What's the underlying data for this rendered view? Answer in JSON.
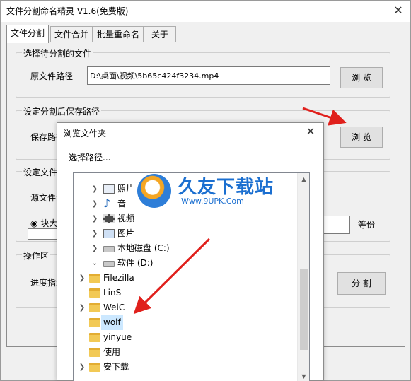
{
  "window": {
    "title": "文件分割命名精灵 V1.6(免费版)",
    "close": "✕"
  },
  "tabs": [
    {
      "label": "文件分割"
    },
    {
      "label": "文件合并"
    },
    {
      "label": "批量重命名"
    },
    {
      "label": "关于"
    }
  ],
  "select_file": {
    "group_title": "选择待分割的文件",
    "label": "原文件路径",
    "value": "D:\\桌面\\视频\\5b65c424f3234.mp4",
    "browse": "浏 览"
  },
  "save_path": {
    "group_title": "设定分割后保存路径",
    "label": "保存路径",
    "browse": "浏 览"
  },
  "settings": {
    "group_title": "设定文件分",
    "size_label": "源文件大",
    "block_label": "块大",
    "equal_label": "等份"
  },
  "operation": {
    "group_title": "操作区",
    "progress_label": "进度指示",
    "split_button": "分 割"
  },
  "dialog": {
    "title": "浏览文件夹",
    "close": "✕",
    "prompt": "选择路径...",
    "tree": [
      {
        "label": "照片",
        "icon": "pictures-icon",
        "expandable": true
      },
      {
        "label": "音",
        "icon": "music-icon",
        "expandable": true
      },
      {
        "label": "视频",
        "icon": "video-icon",
        "expandable": true
      },
      {
        "label": "图片",
        "icon": "pictures-icon",
        "expandable": true
      },
      {
        "label": "本地磁盘 (C:)",
        "icon": "drive-icon",
        "expandable": true
      },
      {
        "label": "软件 (D:)",
        "icon": "drive-icon",
        "expandable": true
      },
      {
        "label": "Filezilla",
        "icon": "folder-icon",
        "expandable": true
      },
      {
        "label": "LinS",
        "icon": "folder-icon",
        "expandable": false
      },
      {
        "label": "WeiC",
        "icon": "folder-icon",
        "expandable": true
      },
      {
        "label": "wolf",
        "icon": "folder-icon",
        "expandable": false,
        "selected": true
      },
      {
        "label": "yinyue",
        "icon": "folder-icon",
        "expandable": false
      },
      {
        "label": "使用",
        "icon": "folder-icon",
        "expandable": false
      },
      {
        "label": "安下载",
        "icon": "folder-icon",
        "expandable": true
      }
    ]
  },
  "watermark": {
    "cn": "久友下载站",
    "en": "Www.9UPK.Com"
  },
  "colors": {
    "arrow": "#e0201c",
    "selection": "#cce8ff",
    "watermark": "#1b6fd0"
  }
}
